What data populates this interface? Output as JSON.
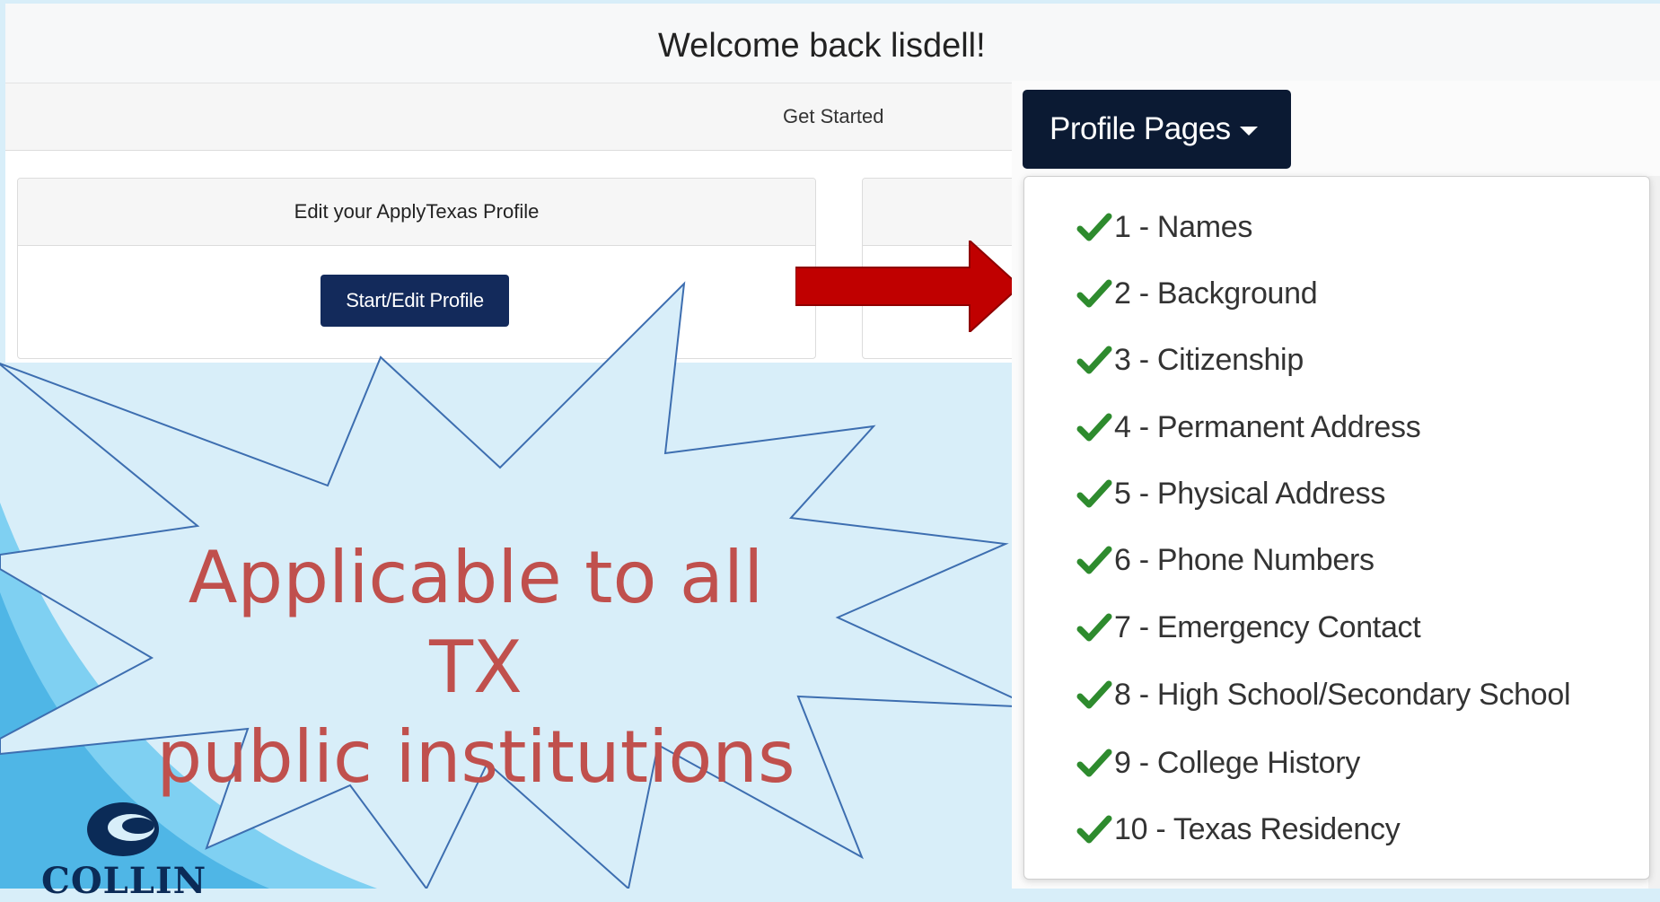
{
  "header": {
    "welcome": "Welcome back lisdell!"
  },
  "nav": {
    "get_started": "Get Started"
  },
  "card_left": {
    "title": "Edit your ApplyTexas Profile",
    "button": "Start/Edit Profile"
  },
  "callout": {
    "line1": "Applicable to all TX",
    "line2": "public institutions"
  },
  "dropdown": {
    "button": "Profile Pages",
    "items": [
      "1 - Names",
      "2 - Background",
      "3 - Citizenship",
      "4 - Permanent Address",
      "5 - Physical Address",
      "6 - Phone Numbers",
      "7 - Emergency Contact",
      "8 - High School/Secondary School",
      "9 - College History",
      "10 - Texas Residency"
    ]
  },
  "logo": {
    "text": "COLLIN"
  },
  "colors": {
    "primary_button": "#132a5b",
    "dropdown_button": "#0b1a33",
    "check": "#2e8b2e",
    "callout_text": "#c0504d",
    "arrow": "#c00000",
    "background": "#d8eef9"
  }
}
